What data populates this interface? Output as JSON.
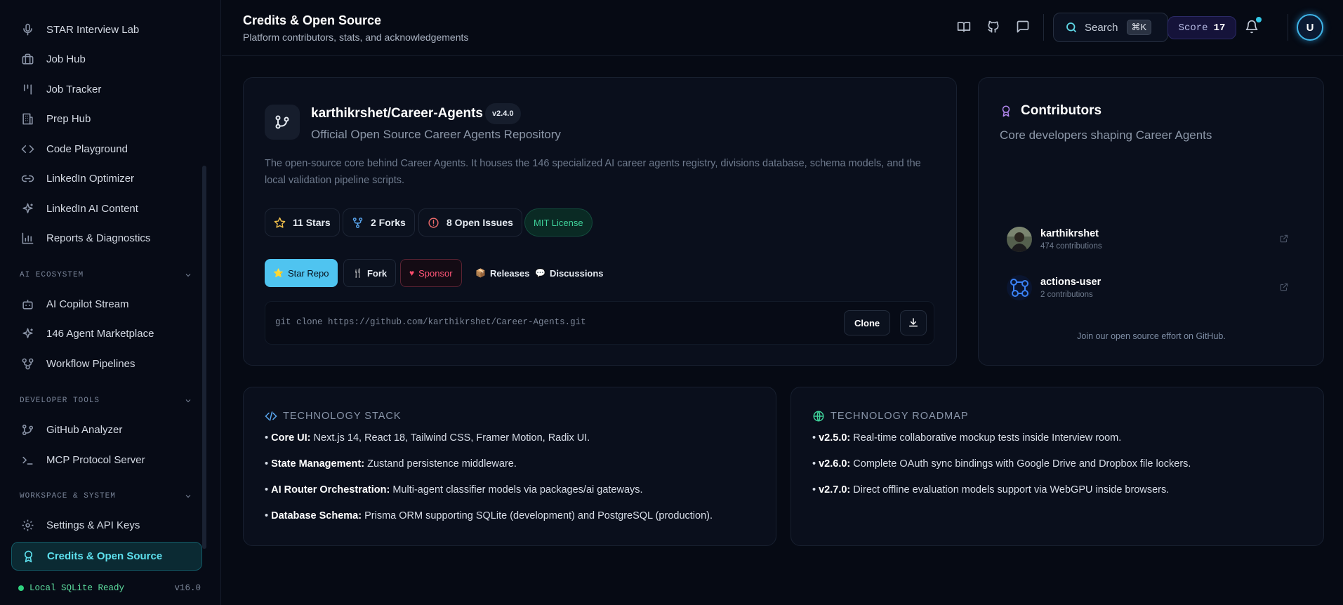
{
  "sidebar": {
    "items": [
      {
        "label": "STAR Interview Lab",
        "icon": "mic-icon"
      },
      {
        "label": "Job Hub",
        "icon": "briefcase-icon"
      },
      {
        "label": "Job Tracker",
        "icon": "kanban-icon"
      },
      {
        "label": "Prep Hub",
        "icon": "building-icon"
      },
      {
        "label": "Code Playground",
        "icon": "code-icon"
      },
      {
        "label": "LinkedIn Optimizer",
        "icon": "link-icon"
      },
      {
        "label": "LinkedIn AI Content",
        "icon": "sparkles-icon"
      },
      {
        "label": "Reports & Diagnostics",
        "icon": "bar-chart-icon"
      }
    ],
    "sections": [
      {
        "title": "AI ECOSYSTEM",
        "items": [
          {
            "label": "AI Copilot Stream",
            "icon": "bot-icon"
          },
          {
            "label": "146 Agent Marketplace",
            "icon": "sparkles-icon"
          },
          {
            "label": "Workflow Pipelines",
            "icon": "workflow-icon"
          }
        ]
      },
      {
        "title": "DEVELOPER TOOLS",
        "items": [
          {
            "label": "GitHub Analyzer",
            "icon": "git-branch-icon"
          },
          {
            "label": "MCP Protocol Server",
            "icon": "terminal-icon"
          }
        ]
      },
      {
        "title": "WORKSPACE & SYSTEM",
        "items": [
          {
            "label": "Settings & API Keys",
            "icon": "gear-icon"
          },
          {
            "label": "Credits & Open Source",
            "icon": "award-icon",
            "active": true
          }
        ]
      }
    ],
    "status": {
      "text": "Local SQLite Ready",
      "version": "v16.0"
    }
  },
  "header": {
    "title": "Credits & Open Source",
    "subtitle": "Platform contributors, stats, and acknowledgements",
    "search_label": "Search",
    "search_shortcut": "⌘K",
    "score_label": "Score",
    "score_value": "17",
    "user_initial": "U"
  },
  "repo": {
    "name": "karthikrshet/Career-Agents",
    "version": "v2.4.0",
    "subtitle": "Official Open Source Career Agents Repository",
    "description": "The open-source core behind Career Agents. It houses the 146 specialized AI career agents registry, divisions database, schema models, and the local validation pipeline scripts.",
    "stats": {
      "stars": "11 Stars",
      "forks": "2 Forks",
      "issues": "8 Open Issues",
      "license": "MIT License"
    },
    "buttons": {
      "star": "Star Repo",
      "fork": "Fork",
      "sponsor": "Sponsor",
      "releases": "Releases",
      "discussions": "Discussions"
    },
    "clone_command": "git clone https://github.com/karthikrshet/Career-Agents.git",
    "clone_label": "Clone"
  },
  "contributors": {
    "title": "Contributors",
    "subtitle": "Core developers shaping Career Agents",
    "people": [
      {
        "name": "karthikrshet",
        "contributions": "474 contributions"
      },
      {
        "name": "actions-user",
        "contributions": "2 contributions"
      }
    ],
    "footer": "Join our open source effort on GitHub."
  },
  "tech_stack": {
    "title": "TECHNOLOGY STACK",
    "items": [
      {
        "key": "Core UI:",
        "value": " Next.js 14, React 18, Tailwind CSS, Framer Motion, Radix UI."
      },
      {
        "key": "State Management:",
        "value": " Zustand persistence middleware."
      },
      {
        "key": "AI Router Orchestration:",
        "value": " Multi-agent classifier models via packages/ai gateways."
      },
      {
        "key": "Database Schema:",
        "value": " Prisma ORM supporting SQLite (development) and PostgreSQL (production)."
      }
    ]
  },
  "roadmap": {
    "title": "TECHNOLOGY ROADMAP",
    "items": [
      {
        "key": "v2.5.0:",
        "value": " Real-time collaborative mockup tests inside Interview room."
      },
      {
        "key": "v2.6.0:",
        "value": " Complete OAuth sync bindings with Google Drive and Dropbox file lockers."
      },
      {
        "key": "v2.7.0:",
        "value": " Direct offline evaluation models support via WebGPU inside browsers."
      }
    ]
  },
  "colors": {
    "accent": "#5de0ee",
    "primary_button": "#4fc4f0",
    "license_green": "#3fd39b",
    "sponsor_red": "#ff5577",
    "contributors_icon": "#b488f0"
  }
}
